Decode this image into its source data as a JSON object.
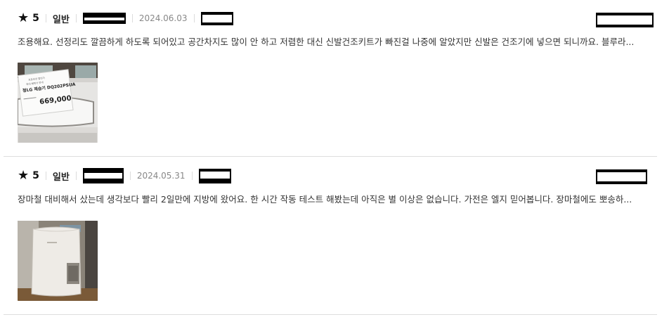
{
  "reviews": [
    {
      "star_icon": "star-icon",
      "rating": "5",
      "type": "일반",
      "date": "2024.06.03",
      "text": "조용해요. 선정리도 깔끔하게 하도록 되어있고 공간차지도 많이 안 하고 저렴한 대신 신발건조키트가 빠진걸 나중에 알았지만 신발은 건조기에 넣으면 되니까요. 블루라...",
      "photo": {
        "kind": "dehumidifier-price-tag-photo",
        "tag_brand": "정LG 제습기 DQ202PSUA",
        "tag_price": "669,000"
      }
    },
    {
      "star_icon": "star-icon",
      "rating": "5",
      "type": "일반",
      "date": "2024.05.31",
      "text": "장마철 대비해서 샀는데 생각보다 빨리 2일만에 지방에 왔어요. 한 시간 작동 테스트 해봤는데 아직은 별 이상은 없습니다. 가전은 엘지 믿어봅니다. 장마철에도 뽀송하...",
      "photo": {
        "kind": "dehumidifier-product-photo"
      }
    }
  ]
}
